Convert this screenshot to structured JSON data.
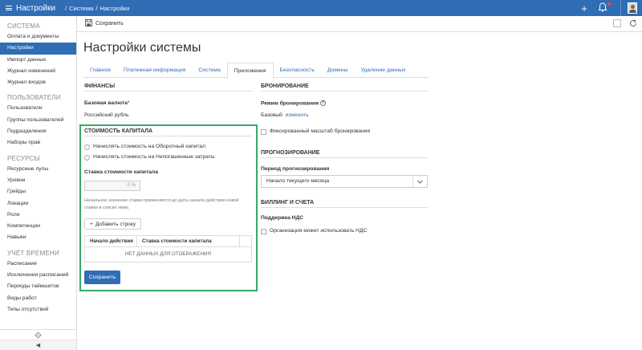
{
  "topbar": {
    "app_title": "Настройки",
    "breadcrumb": [
      "Система",
      "Настройки"
    ],
    "separator": "/"
  },
  "sidebar": {
    "groups": [
      {
        "title": "СИСТЕМА",
        "items": [
          "Оплата и документы",
          "Настройки",
          "Импорт данных",
          "Журнал изменений",
          "Журнал входов"
        ],
        "active": 1
      },
      {
        "title": "ПОЛЬЗОВАТЕЛИ",
        "items": [
          "Пользователи",
          "Группы пользователей",
          "Подразделения",
          "Наборы прав"
        ]
      },
      {
        "title": "РЕСУРСЫ",
        "items": [
          "Ресурсные пулы",
          "Уровни",
          "Грейды",
          "Локации",
          "Роли",
          "Компетенции",
          "Навыки"
        ]
      },
      {
        "title": "УЧЁТ ВРЕМЕНИ",
        "items": [
          "Расписания",
          "Исключения расписаний",
          "Периоды таймшитов",
          "Виды работ",
          "Типы отсутствий"
        ]
      }
    ],
    "collapse_label": "◀"
  },
  "toolbar": {
    "save_label": "Сохранить"
  },
  "page": {
    "title": "Настройки системы"
  },
  "tabs": [
    "Главное",
    "Платежная информация",
    "Система",
    "Приложения",
    "Безопасность",
    "Домены",
    "Удаление данных"
  ],
  "active_tab": 3,
  "finance": {
    "header": "ФИНАНСЫ",
    "currency_label": "Базовая валюта",
    "required_mark": "*",
    "currency_value": "Российский рубль"
  },
  "capital": {
    "header": "СТОИМОСТЬ КАПИТАЛА",
    "option_working": "Начислять стоимость на Оборотный капитал",
    "option_unamortized": "Начислять стоимость на Непогашенные затраты",
    "rate_label": "Ставка стоимости капитала",
    "rate_value": "0 %",
    "hint": "Начальное значение ставки применяется до даты начала действия новой ставки в списке ниже.",
    "add_row_label": "Добавить строку",
    "add_row_icon": "+",
    "col_start": "Начало действия",
    "col_rate": "Ставка стоимости капитала",
    "empty_text": "НЕТ ДАННЫХ ДЛЯ ОТОБРАЖЕНИЯ",
    "save_label": "Сохранить"
  },
  "booking": {
    "header": "БРОНИРОВАНИЕ",
    "mode_label": "Режим бронирования",
    "help_glyph": "?",
    "mode_value": "Базовый",
    "change_link": "изменить",
    "fixed_scale": "Фиксированный масштаб бронирования"
  },
  "forecast": {
    "header": "ПРОГНОЗИРОВАНИЕ",
    "period_label": "Период прогнозирования",
    "period_value": "Начало текущего месяца"
  },
  "billing": {
    "header": "БИЛЛИНГ И СЧЕТА",
    "vat_label": "Поддержка НДС",
    "vat_option": "Организация может использовать НДС"
  },
  "colors": {
    "brand": "#2f6db5",
    "highlight": "#3aa86b",
    "required": "#e04040"
  },
  "icons": [
    "menu-icon",
    "plus-icon",
    "bell-icon",
    "avatar",
    "save-icon",
    "gear-icon",
    "chevron-down-icon",
    "refresh-icon"
  ]
}
